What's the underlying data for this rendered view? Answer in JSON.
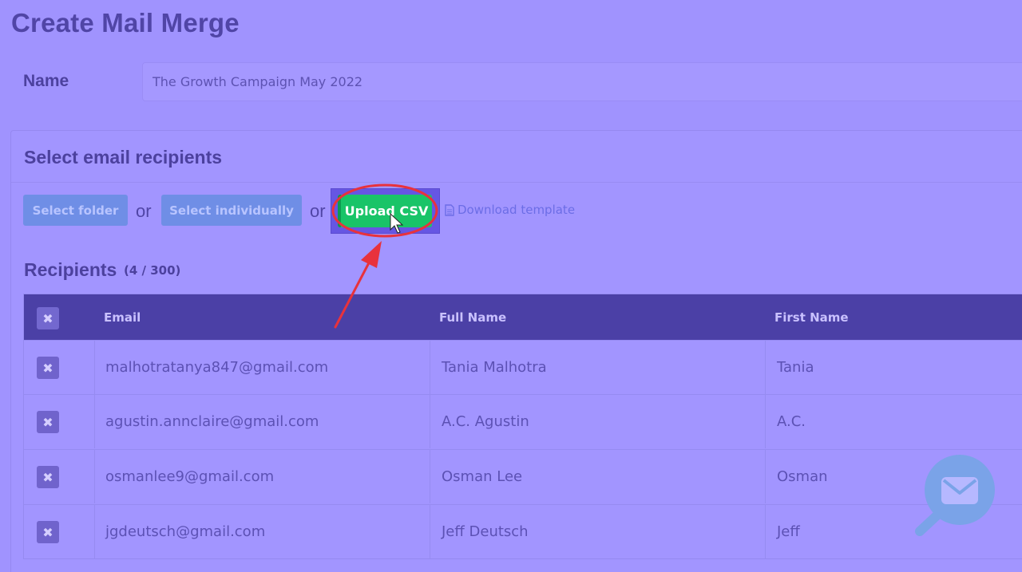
{
  "page": {
    "title": "Create Mail Merge"
  },
  "name_field": {
    "label": "Name",
    "value": "The Growth Campaign May 2022"
  },
  "recipients_section": {
    "title": "Select email recipients",
    "buttons": {
      "select_folder": "Select folder",
      "or_1": "or",
      "select_individually": "Select individually",
      "or_2": "or",
      "upload_csv": "Upload CSV",
      "download_template": "Download template"
    }
  },
  "recipients": {
    "title": "Recipients",
    "count": "(4 / 300)",
    "columns": [
      "Email",
      "Full Name",
      "First Name"
    ],
    "rows": [
      {
        "email": "malhotratanya847@gmail.com",
        "full_name": "Tania Malhotra",
        "first_name": "Tania"
      },
      {
        "email": "agustin.annclaire@gmail.com",
        "full_name": "A.C. Agustin",
        "first_name": "A.C."
      },
      {
        "email": "osmanlee9@gmail.com",
        "full_name": "Osman Lee",
        "first_name": "Osman"
      },
      {
        "email": "jgdeutsch@gmail.com",
        "full_name": "Jeff Deutsch",
        "first_name": "Jeff"
      }
    ]
  },
  "icons": {
    "remove": "close-x-icon",
    "document": "document-icon",
    "floating": "mail-search-icon"
  },
  "colors": {
    "background": "#a093fe",
    "accent": "#19c468",
    "header": "#4b40a6",
    "annotation": "#e8323c"
  }
}
